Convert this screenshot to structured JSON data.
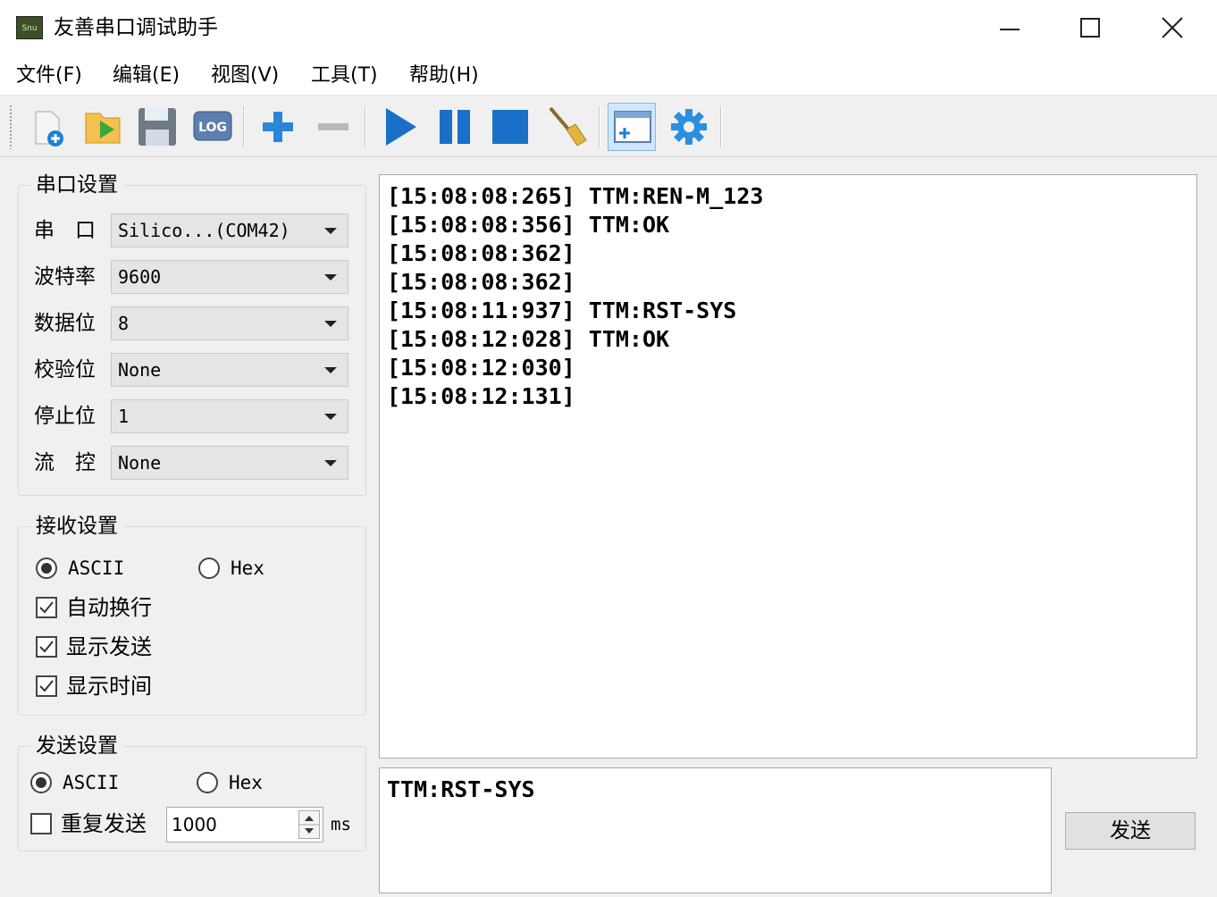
{
  "window": {
    "title": "友善串口调试助手",
    "app_icon_text": "Snu"
  },
  "menu": [
    {
      "label": "文件(F)"
    },
    {
      "label": "编辑(E)"
    },
    {
      "label": "视图(V)"
    },
    {
      "label": "工具(T)"
    },
    {
      "label": "帮助(H)"
    }
  ],
  "toolbar": {
    "icons": [
      "new-session-icon",
      "open-folder-icon",
      "save-icon",
      "log-icon",
      "add-icon",
      "remove-icon",
      "play-icon",
      "pause-icon",
      "stop-icon",
      "clear-broom-icon",
      "new-window-icon",
      "settings-gear-icon"
    ],
    "log_text": "LOG",
    "active_icon": "new-window-icon"
  },
  "serial_settings": {
    "title": "串口设置",
    "fields": [
      {
        "label": "串　口",
        "value": "Silico...(COM42)"
      },
      {
        "label": "波特率",
        "value": "9600"
      },
      {
        "label": "数据位",
        "value": "8"
      },
      {
        "label": "校验位",
        "value": "None"
      },
      {
        "label": "停止位",
        "value": "1"
      },
      {
        "label": "流　控",
        "value": "None"
      }
    ]
  },
  "receive_settings": {
    "title": "接收设置",
    "ascii_label": "ASCII",
    "hex_label": "Hex",
    "selected": "ASCII",
    "auto_wrap": {
      "label": "自动换行",
      "checked": true
    },
    "show_send": {
      "label": "显示发送",
      "checked": true
    },
    "show_time": {
      "label": "显示时间",
      "checked": true
    }
  },
  "send_settings": {
    "title": "发送设置",
    "ascii_label": "ASCII",
    "hex_label": "Hex",
    "selected": "ASCII",
    "repeat": {
      "label": "重复发送",
      "checked": false
    },
    "interval": "1000",
    "unit": "ms"
  },
  "receive_log": [
    "[15:08:08:265] TTM:REN-M_123",
    "[15:08:08:356] TTM:OK",
    "[15:08:08:362]",
    "[15:08:08:362]",
    "[15:08:11:937] TTM:RST-SYS",
    "[15:08:12:028] TTM:OK",
    "[15:08:12:030]",
    "[15:08:12:131]"
  ],
  "send_input": "TTM:RST-SYS",
  "send_button": "发送",
  "colors": {
    "accent_blue": "#1f7fd6",
    "play_blue": "#1a6fc8",
    "background": "#f0f0f0"
  }
}
